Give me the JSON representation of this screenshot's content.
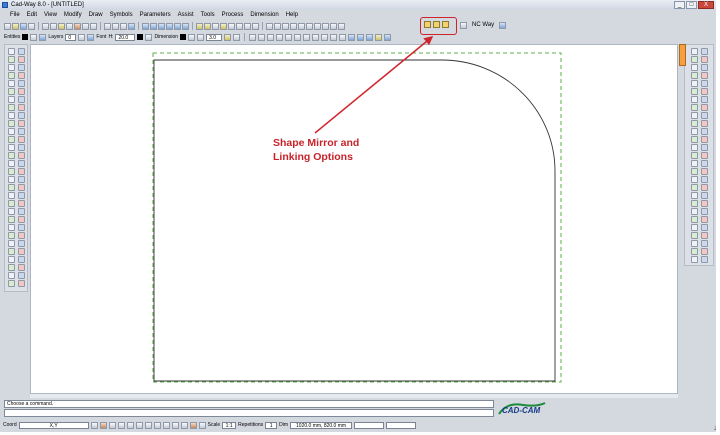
{
  "window": {
    "title": "Cad-Way 8.0 - [UNTITLED]",
    "minimize": "_",
    "maximize": "□",
    "close": "X"
  },
  "menu": [
    "File",
    "Edit",
    "View",
    "Modify",
    "Draw",
    "Symbols",
    "Parameters",
    "Assist",
    "Tools",
    "Process",
    "Dimension",
    "Help"
  ],
  "toolbar": {
    "nc_way_label": "NC Way"
  },
  "props": {
    "entities_label": "Entities",
    "layers_label": "Layers",
    "layer_value": "0",
    "font_label": "Font",
    "font_h_label": "H:",
    "font_size": "20.0",
    "dimension_label": "Dimension",
    "dim_value": "3.0"
  },
  "annotation": {
    "text_line1": "Shape Mirror and",
    "text_line2": "Linking Options",
    "color": "#c8222a"
  },
  "command": {
    "prompt": "Choose a command."
  },
  "logo": {
    "text": "CAD-CAM"
  },
  "status": {
    "coord_label": "Coord",
    "coord_value": "X,Y",
    "scale_label": "Scale",
    "scale_value": "1:1",
    "repetitions_label": "Repetitions",
    "repetitions_value": "1",
    "dim_label": "Dim",
    "dim_value": "1020.0 mm, 820.0 mm"
  },
  "colors": {
    "accent_highlight": "#d0242c",
    "margin_dash": "#5bb04a",
    "logo": "#1e8a3c"
  }
}
